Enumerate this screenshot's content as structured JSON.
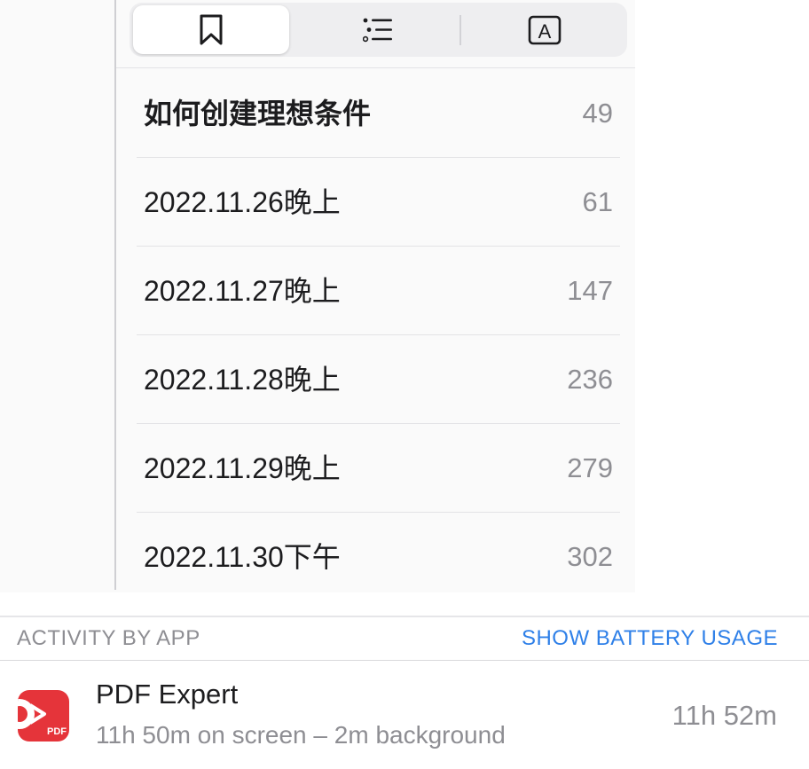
{
  "toolbar": {
    "tabs": [
      {
        "icon": "bookmark-icon",
        "active": true
      },
      {
        "icon": "list-icon",
        "active": false
      },
      {
        "icon": "text-format-icon",
        "active": false,
        "glyph": "A"
      }
    ]
  },
  "bookmarks": [
    {
      "title": "如何创建理想条件",
      "page": "49",
      "bold": true
    },
    {
      "title": "2022.11.26晚上",
      "page": "61"
    },
    {
      "title": "2022.11.27晚上",
      "page": "147"
    },
    {
      "title": "2022.11.28晚上",
      "page": "236"
    },
    {
      "title": "2022.11.29晚上",
      "page": "279"
    },
    {
      "title": "2022.11.30下午",
      "page": "302"
    }
  ],
  "activity": {
    "section_title": "ACTIVITY BY APP",
    "show_battery_label": "SHOW BATTERY USAGE",
    "app": {
      "name": "PDF Expert",
      "detail": "11h 50m on screen – 2m background",
      "total": "11h 52m",
      "icon": "pdf-expert-app-icon",
      "icon_badge": "PDF",
      "icon_color": "#e5343a"
    }
  },
  "colors": {
    "accent": "#2f80e8",
    "secondary_text": "#8e8e93"
  }
}
